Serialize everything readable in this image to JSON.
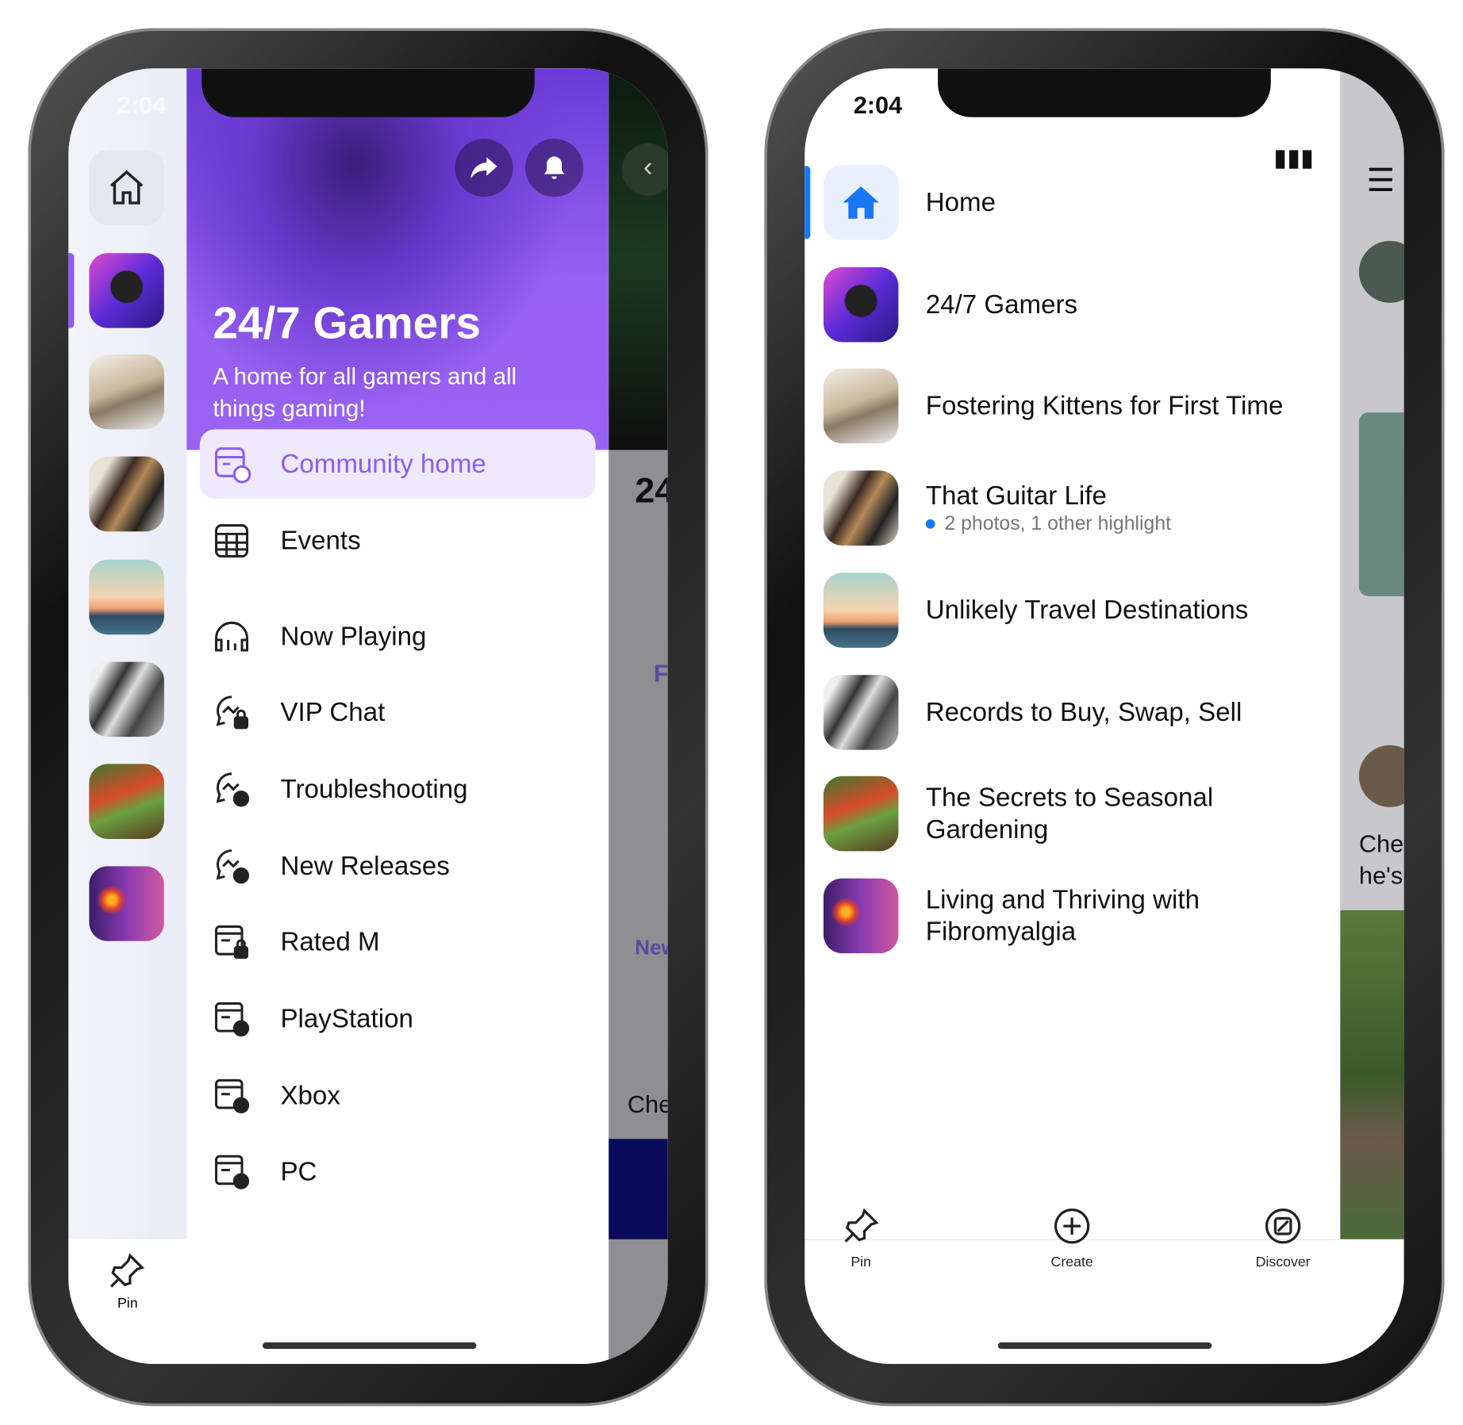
{
  "left_phone": {
    "status_time": "2:04",
    "community": {
      "title": "24/7 Gamers",
      "description": "A home for all gamers and all things gaming!"
    },
    "header_actions": [
      {
        "icon": "share-icon"
      },
      {
        "icon": "bell-icon"
      }
    ],
    "menu": [
      {
        "label": "Community home",
        "icon": "community-home-icon",
        "active": true
      },
      {
        "label": "Events",
        "icon": "calendar-icon"
      },
      {
        "label": "Now Playing",
        "icon": "headphones-icon"
      },
      {
        "label": "VIP Chat",
        "icon": "chat-lock-icon"
      },
      {
        "label": "Troubleshooting",
        "icon": "chat-globe-icon"
      },
      {
        "label": "New Releases",
        "icon": "chat-globe-icon"
      },
      {
        "label": "Rated M",
        "icon": "board-lock-icon"
      },
      {
        "label": "PlayStation",
        "icon": "board-globe-icon"
      },
      {
        "label": "Xbox",
        "icon": "board-globe-icon"
      },
      {
        "label": "PC",
        "icon": "board-globe-icon"
      }
    ],
    "background_peek": {
      "title_fragment": "24",
      "chip_fragment": "F",
      "label_fragment": "New",
      "text_fragment": "Che"
    },
    "bottom_tab": {
      "label": "Pin",
      "icon": "pin-icon"
    },
    "accent": "#8b5cf6"
  },
  "right_phone": {
    "status_time": "2:04",
    "list": [
      {
        "label": "Home",
        "icon": "home-icon",
        "active": true
      },
      {
        "label": "24/7 Gamers"
      },
      {
        "label": "Fostering Kittens for First Time"
      },
      {
        "label": "That Guitar Life",
        "subtitle": "2 photos, 1 other highlight"
      },
      {
        "label": "Unlikely Travel Destinations"
      },
      {
        "label": "Records to Buy, Swap, Sell"
      },
      {
        "label": "The Secrets to Seasonal Gardening"
      },
      {
        "label": "Living and Thriving with Fibromyalgia"
      }
    ],
    "background_peek": {
      "text_fragment_1": "Che",
      "text_fragment_2": "he's"
    },
    "tabs": [
      {
        "label": "Pin",
        "icon": "pin-icon"
      },
      {
        "label": "Create",
        "icon": "plus-circle-icon"
      },
      {
        "label": "Discover",
        "icon": "compass-icon"
      }
    ],
    "accent": "#1877f2"
  }
}
